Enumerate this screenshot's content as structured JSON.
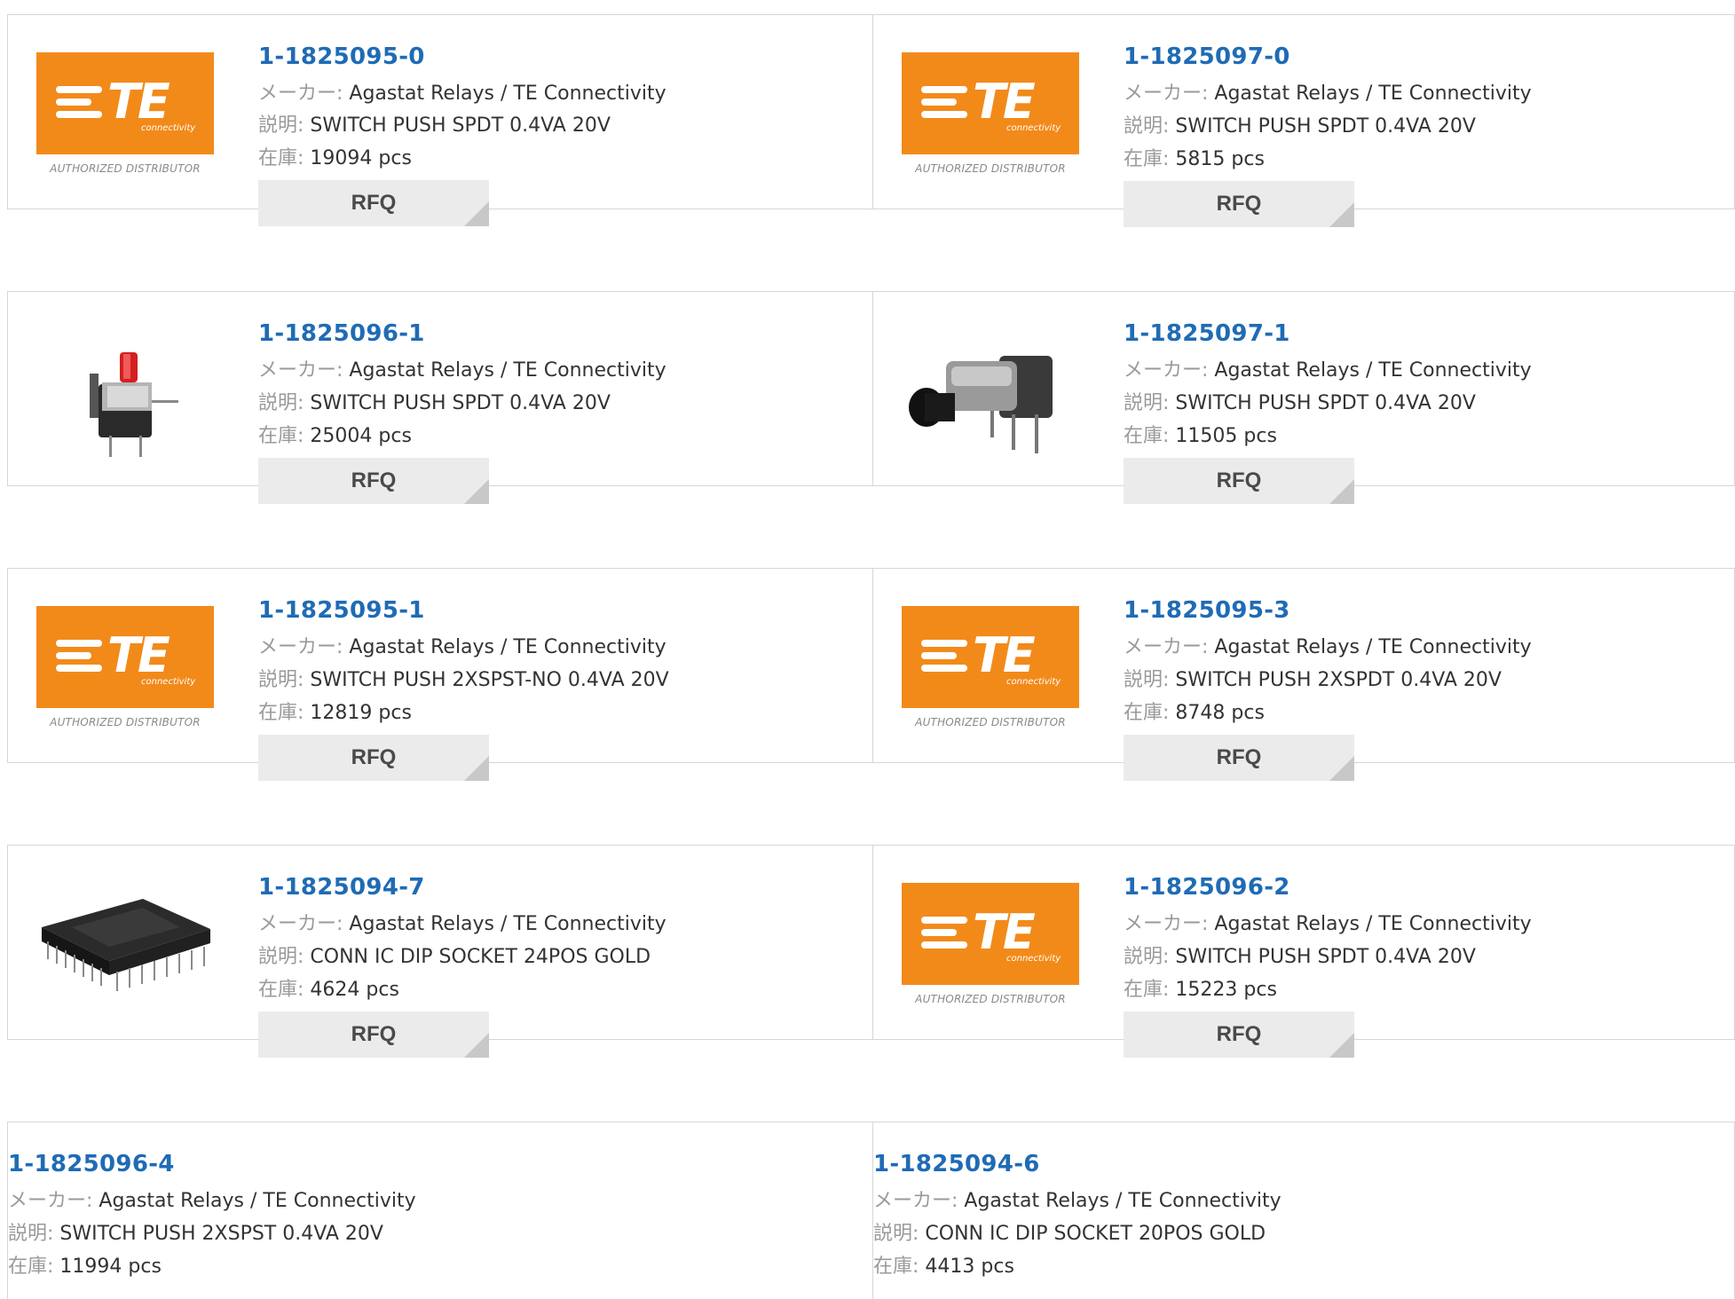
{
  "labels": {
    "maker": "メーカー:",
    "desc": "説明:",
    "stock": "在庫:"
  },
  "rfq_label": "RFQ",
  "logo": {
    "brand": "TE",
    "sub": "connectivity",
    "authorized": "AUTHORIZED DISTRIBUTOR"
  },
  "products": [
    {
      "pn": "1-1825095-0",
      "maker": "Agastat Relays / TE Connectivity",
      "desc": "SWITCH PUSH SPDT 0.4VA 20V",
      "stock": "19094 pcs",
      "image": "te-logo"
    },
    {
      "pn": "1-1825097-0",
      "maker": "Agastat Relays / TE Connectivity",
      "desc": "SWITCH PUSH SPDT 0.4VA 20V",
      "stock": "5815 pcs",
      "image": "te-logo"
    },
    {
      "pn": "1-1825096-1",
      "maker": "Agastat Relays / TE Connectivity",
      "desc": "SWITCH PUSH SPDT 0.4VA 20V",
      "stock": "25004 pcs",
      "image": "red-push-switch"
    },
    {
      "pn": "1-1825097-1",
      "maker": "Agastat Relays / TE Connectivity",
      "desc": "SWITCH PUSH SPDT 0.4VA 20V",
      "stock": "11505 pcs",
      "image": "black-push-switch"
    },
    {
      "pn": "1-1825095-1",
      "maker": "Agastat Relays / TE Connectivity",
      "desc": "SWITCH PUSH 2XSPST-NO 0.4VA 20V",
      "stock": "12819 pcs",
      "image": "te-logo"
    },
    {
      "pn": "1-1825095-3",
      "maker": "Agastat Relays / TE Connectivity",
      "desc": "SWITCH PUSH 2XSPDT 0.4VA 20V",
      "stock": "8748 pcs",
      "image": "te-logo"
    },
    {
      "pn": "1-1825094-7",
      "maker": "Agastat Relays / TE Connectivity",
      "desc": "CONN IC DIP SOCKET 24POS GOLD",
      "stock": "4624 pcs",
      "image": "dip-socket"
    },
    {
      "pn": "1-1825096-2",
      "maker": "Agastat Relays / TE Connectivity",
      "desc": "SWITCH PUSH SPDT 0.4VA 20V",
      "stock": "15223 pcs",
      "image": "te-logo"
    },
    {
      "pn": "1-1825096-4",
      "maker": "Agastat Relays / TE Connectivity",
      "desc": "SWITCH PUSH 2XSPST 0.4VA 20V",
      "stock": "11994 pcs"
    },
    {
      "pn": "1-1825094-6",
      "maker": "Agastat Relays / TE Connectivity",
      "desc": "CONN IC DIP SOCKET 20POS GOLD",
      "stock": "4413 pcs"
    }
  ]
}
